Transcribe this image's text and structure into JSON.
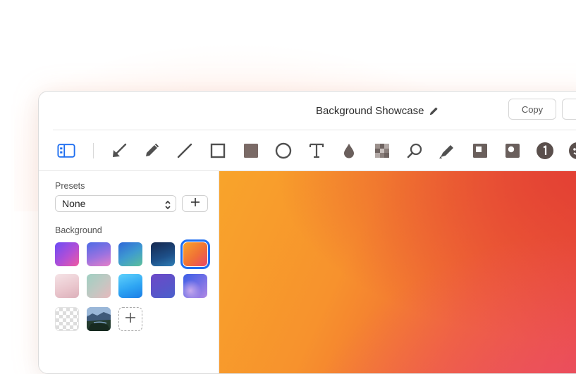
{
  "window": {
    "title": "Background Showcase",
    "copy_label": "Copy"
  },
  "toolbar": {
    "tools": [
      {
        "icon": "sidebar-toggle-icon"
      },
      {
        "icon": "arrow-icon"
      },
      {
        "icon": "pencil-icon"
      },
      {
        "icon": "line-icon"
      },
      {
        "icon": "rectangle-icon"
      },
      {
        "icon": "filled-rectangle-icon"
      },
      {
        "icon": "ellipse-icon"
      },
      {
        "icon": "text-icon"
      },
      {
        "icon": "blur-drop-icon"
      },
      {
        "icon": "pixelate-icon"
      },
      {
        "icon": "magnify-icon"
      },
      {
        "icon": "highlighter-icon"
      },
      {
        "icon": "spotlight-square-icon"
      },
      {
        "icon": "spotlight-circle-icon"
      },
      {
        "icon": "counter-icon",
        "text": "1"
      },
      {
        "icon": "emoji-icon"
      }
    ],
    "accent": "#1e6ef0"
  },
  "sidebar": {
    "presets_label": "Presets",
    "preset_value": "None",
    "background_label": "Background",
    "swatches": [
      {
        "name": "purple-pink",
        "selected": false
      },
      {
        "name": "blue-violet",
        "selected": false
      },
      {
        "name": "blue-teal",
        "selected": false
      },
      {
        "name": "deep-navy",
        "selected": false
      },
      {
        "name": "orange-pink",
        "selected": true
      },
      {
        "name": "pale-pink",
        "selected": false
      },
      {
        "name": "sage-pink",
        "selected": false
      },
      {
        "name": "sky-blue",
        "selected": false
      },
      {
        "name": "indigo",
        "selected": false
      },
      {
        "name": "blue-violet-mesh",
        "selected": false
      },
      {
        "name": "transparent",
        "selected": false
      },
      {
        "name": "landscape-photo",
        "selected": false
      },
      {
        "name": "add-custom",
        "selected": false
      }
    ]
  },
  "canvas": {
    "background": "orange-pink gradient"
  }
}
